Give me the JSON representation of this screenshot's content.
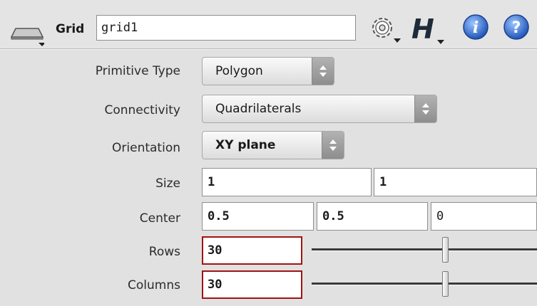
{
  "header": {
    "node_type": "Grid",
    "node_name": "grid1",
    "icons": [
      "node-shape-icon",
      "gear-icon",
      "houdini-h-icon",
      "info-icon",
      "help-icon"
    ]
  },
  "params": {
    "primitive_type": {
      "label": "Primitive Type",
      "value": "Polygon"
    },
    "connectivity": {
      "label": "Connectivity",
      "value": "Quadrilaterals"
    },
    "orientation": {
      "label": "Orientation",
      "value": "XY plane"
    },
    "size": {
      "label": "Size",
      "x": "1",
      "y": "1"
    },
    "center": {
      "label": "Center",
      "x": "0.5",
      "y": "0.5",
      "z": "0"
    },
    "rows": {
      "label": "Rows",
      "value": "30"
    },
    "columns": {
      "label": "Columns",
      "value": "30"
    }
  },
  "colors": {
    "accent_red": "#a01313",
    "info_blue": "#2f6bd1"
  }
}
